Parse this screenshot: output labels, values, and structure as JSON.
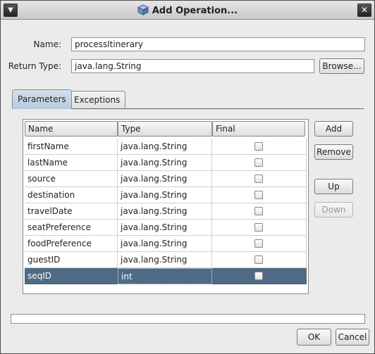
{
  "window": {
    "title": "Add Operation..."
  },
  "form": {
    "name_label": "Name:",
    "name_value": "processItinerary",
    "return_type_label": "Return Type:",
    "return_type_value": "java.lang.String",
    "browse_label": "Browse..."
  },
  "tabs": [
    {
      "label": "Parameters",
      "active": true
    },
    {
      "label": "Exceptions",
      "active": false
    }
  ],
  "table": {
    "columns": [
      "Name",
      "Type",
      "Final"
    ],
    "rows": [
      {
        "name": "firstName",
        "type": "java.lang.String",
        "final": false,
        "selected": false
      },
      {
        "name": "lastName",
        "type": "java.lang.String",
        "final": false,
        "selected": false
      },
      {
        "name": "source",
        "type": "java.lang.String",
        "final": false,
        "selected": false
      },
      {
        "name": "destination",
        "type": "java.lang.String",
        "final": false,
        "selected": false
      },
      {
        "name": "travelDate",
        "type": "java.lang.String",
        "final": false,
        "selected": false
      },
      {
        "name": "seatPreference",
        "type": "java.lang.String",
        "final": false,
        "selected": false
      },
      {
        "name": "foodPreference",
        "type": "java.lang.String",
        "final": false,
        "selected": false
      },
      {
        "name": "guestID",
        "type": "java.lang.String",
        "final": false,
        "selected": false
      },
      {
        "name": "seqID",
        "type": "int",
        "final": false,
        "selected": true
      }
    ]
  },
  "side_buttons": {
    "add": "Add",
    "remove": "Remove",
    "up": "Up",
    "down": "Down"
  },
  "dialog_buttons": {
    "ok": "OK",
    "cancel": "Cancel"
  },
  "colors": {
    "selection": "#4f6a84",
    "active_tab": "#c4d5e6"
  }
}
